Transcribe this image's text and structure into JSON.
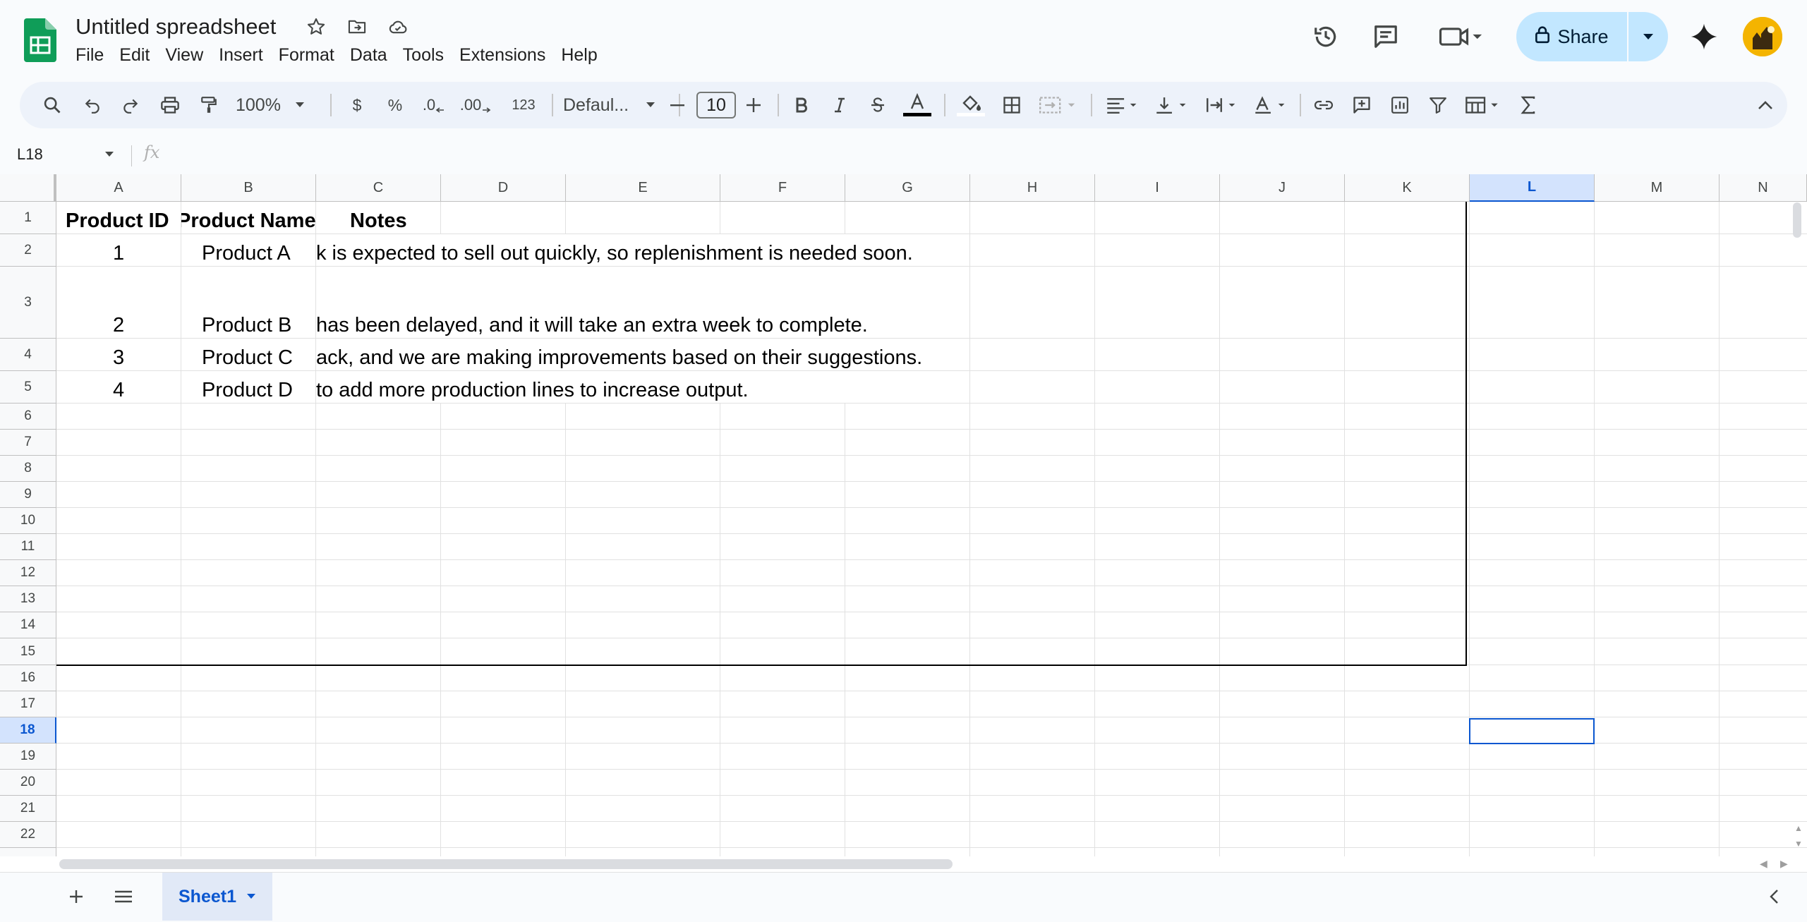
{
  "header": {
    "title": "Untitled spreadsheet",
    "menu": [
      "File",
      "Edit",
      "View",
      "Insert",
      "Format",
      "Data",
      "Tools",
      "Extensions",
      "Help"
    ],
    "share_label": "Share"
  },
  "toolbar": {
    "zoom": "100%",
    "currency": "$",
    "percent": "%",
    "decrease_decimal": ".0",
    "increase_decimal": ".00",
    "more_formats": "123",
    "font": "Defaul...",
    "font_size": "10"
  },
  "formula_bar": {
    "cell_ref": "L18",
    "fx_label": "fx",
    "formula": ""
  },
  "grid": {
    "columns": [
      "A",
      "B",
      "C",
      "D",
      "E",
      "F",
      "G",
      "H",
      "I",
      "J",
      "K",
      "L",
      "M",
      "N"
    ],
    "selected_column": "L",
    "rows": [
      "1",
      "2",
      "3",
      "4",
      "5",
      "6",
      "7",
      "8",
      "9",
      "10",
      "11",
      "12",
      "13",
      "14",
      "15",
      "16",
      "17",
      "18",
      "19",
      "20",
      "21",
      "22"
    ],
    "selected_row": "18",
    "header_row": {
      "product_id": "Product ID",
      "product_name": "Product Name",
      "notes": "Notes"
    },
    "data_rows": [
      {
        "id": "1",
        "name": "Product A",
        "notes": "k is expected to sell out quickly, so replenishment is needed soon."
      },
      {
        "id": "2",
        "name": "Product B",
        "notes": "has been delayed, and it will take an extra week to complete."
      },
      {
        "id": "3",
        "name": "Product C",
        "notes": "ack, and we are making improvements based on their suggestions."
      },
      {
        "id": "4",
        "name": "Product D",
        "notes": "to add more production lines to increase output."
      }
    ]
  },
  "sheets": {
    "tabs": [
      "Sheet1"
    ],
    "active": "Sheet1"
  },
  "colors": {
    "accent": "#0b57d0",
    "share_bg": "#c2e7ff",
    "sheets_green": "#0f9d58"
  }
}
